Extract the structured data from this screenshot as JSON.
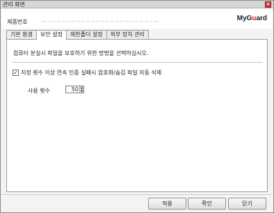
{
  "window": {
    "title": "관리 화면",
    "close_glyph": "×"
  },
  "header": {
    "product_label": "제품번호",
    "product_value": "~~~~~~~~~~~~~~~~~~~~~~~~",
    "logo_my": "MyG",
    "logo_u": "u",
    "logo_rest": "ard"
  },
  "tabs": [
    {
      "label": "기본 환경",
      "active": false
    },
    {
      "label": "보안 설정",
      "active": true
    },
    {
      "label": "제한폴더 설정",
      "active": false
    },
    {
      "label": "외부 장치 관리",
      "active": false
    }
  ],
  "security": {
    "description": "컴퓨터 분실시 파일을 보호하기 위한 방법을 선택하십시오.",
    "checkbox_checked": true,
    "checkbox_label": "지정 횟수 이상 연속 인증 실패시 암호화/숨김 파일 자동 삭제",
    "count_label": "사용 횟수",
    "count_value": "50"
  },
  "buttons": {
    "apply": "적용",
    "ok": "확인",
    "close": "닫기"
  },
  "colors": {
    "accent_red": "#d11f1f",
    "title_close": "#c8362f"
  }
}
